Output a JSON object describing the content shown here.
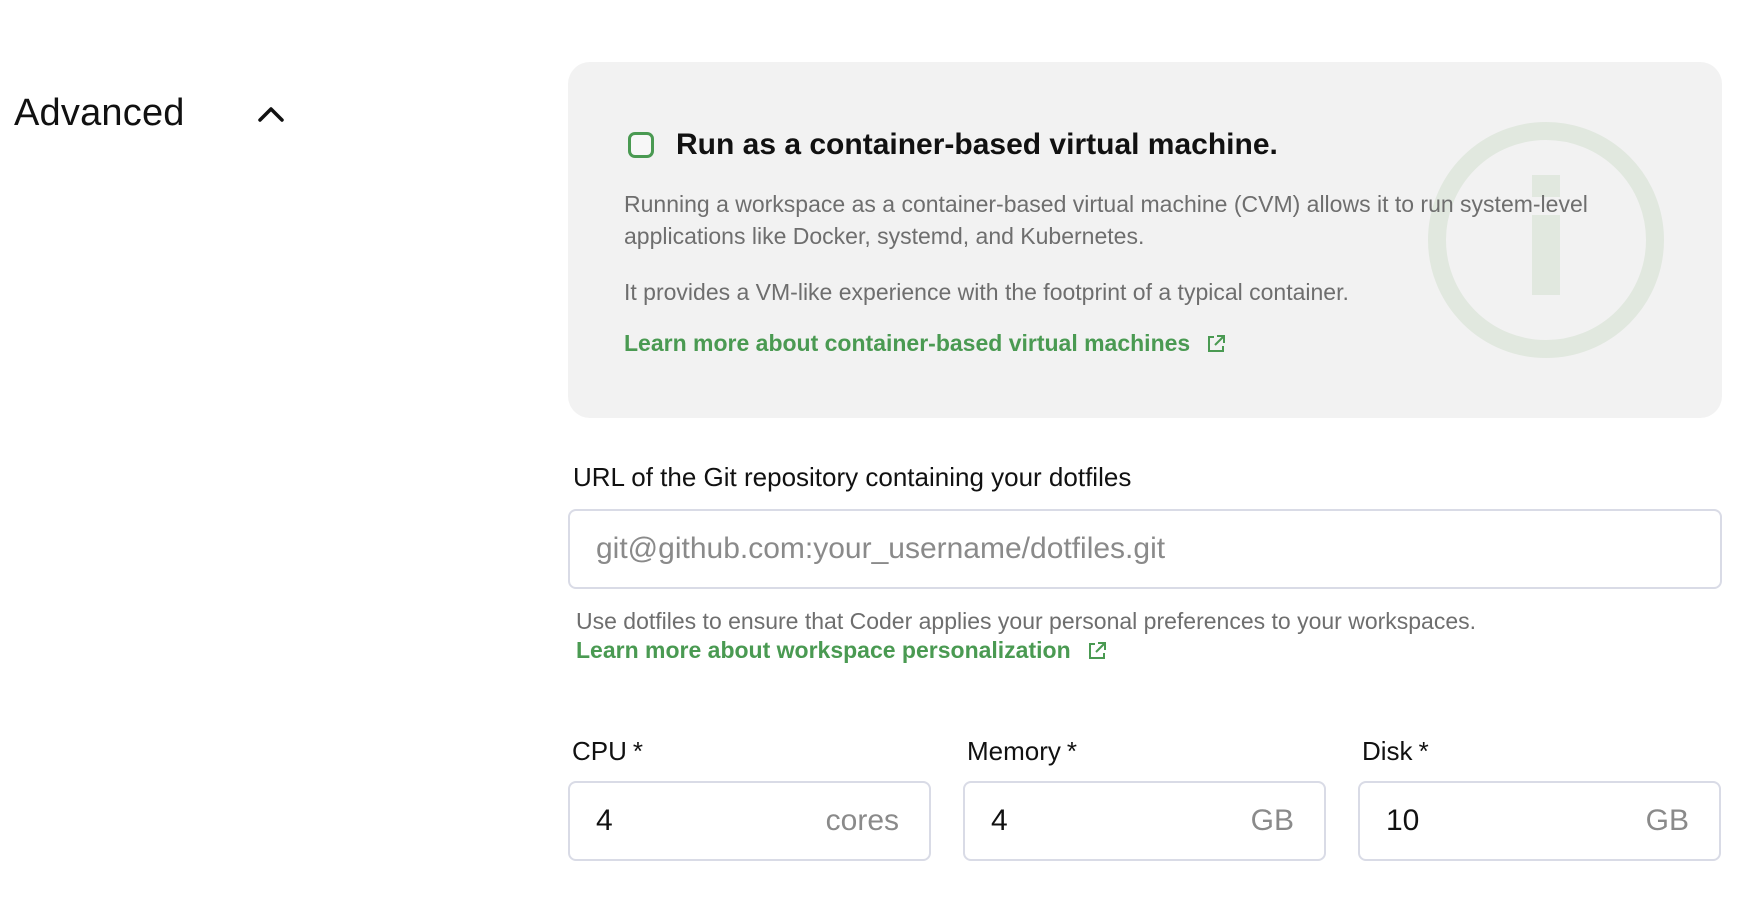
{
  "section": {
    "title": "Advanced",
    "toggle_icon": "chevron-up-icon"
  },
  "cvm": {
    "checkbox_label": "Run as a container-based virtual machine.",
    "checked": false,
    "description_1": "Running a workspace as a container-based virtual machine (CVM) allows it to run system-level applications like Docker, systemd, and Kubernetes.",
    "description_2": "It provides a VM-like experience with the footprint of a typical container.",
    "link_text": "Learn more about container-based virtual machines",
    "watermark_icon": "info-icon"
  },
  "dotfiles": {
    "label": "URL of the Git repository containing your dotfiles",
    "placeholder": "git@github.com:your_username/dotfiles.git",
    "value": "",
    "helper": "Use dotfiles to ensure that Coder applies your personal preferences to your workspaces.",
    "link_text": "Learn more about workspace personalization"
  },
  "resources": {
    "cpu": {
      "label": "CPU",
      "required_mark": "*",
      "value": "4",
      "unit": "cores"
    },
    "memory": {
      "label": "Memory",
      "required_mark": "*",
      "value": "4",
      "unit": "GB"
    },
    "disk": {
      "label": "Disk",
      "required_mark": "*",
      "value": "10",
      "unit": "GB"
    }
  },
  "colors": {
    "accent": "#4a9a52",
    "card_background": "#f2f2f2",
    "muted_text": "#6e6e6e",
    "border": "#d9dbe6"
  }
}
